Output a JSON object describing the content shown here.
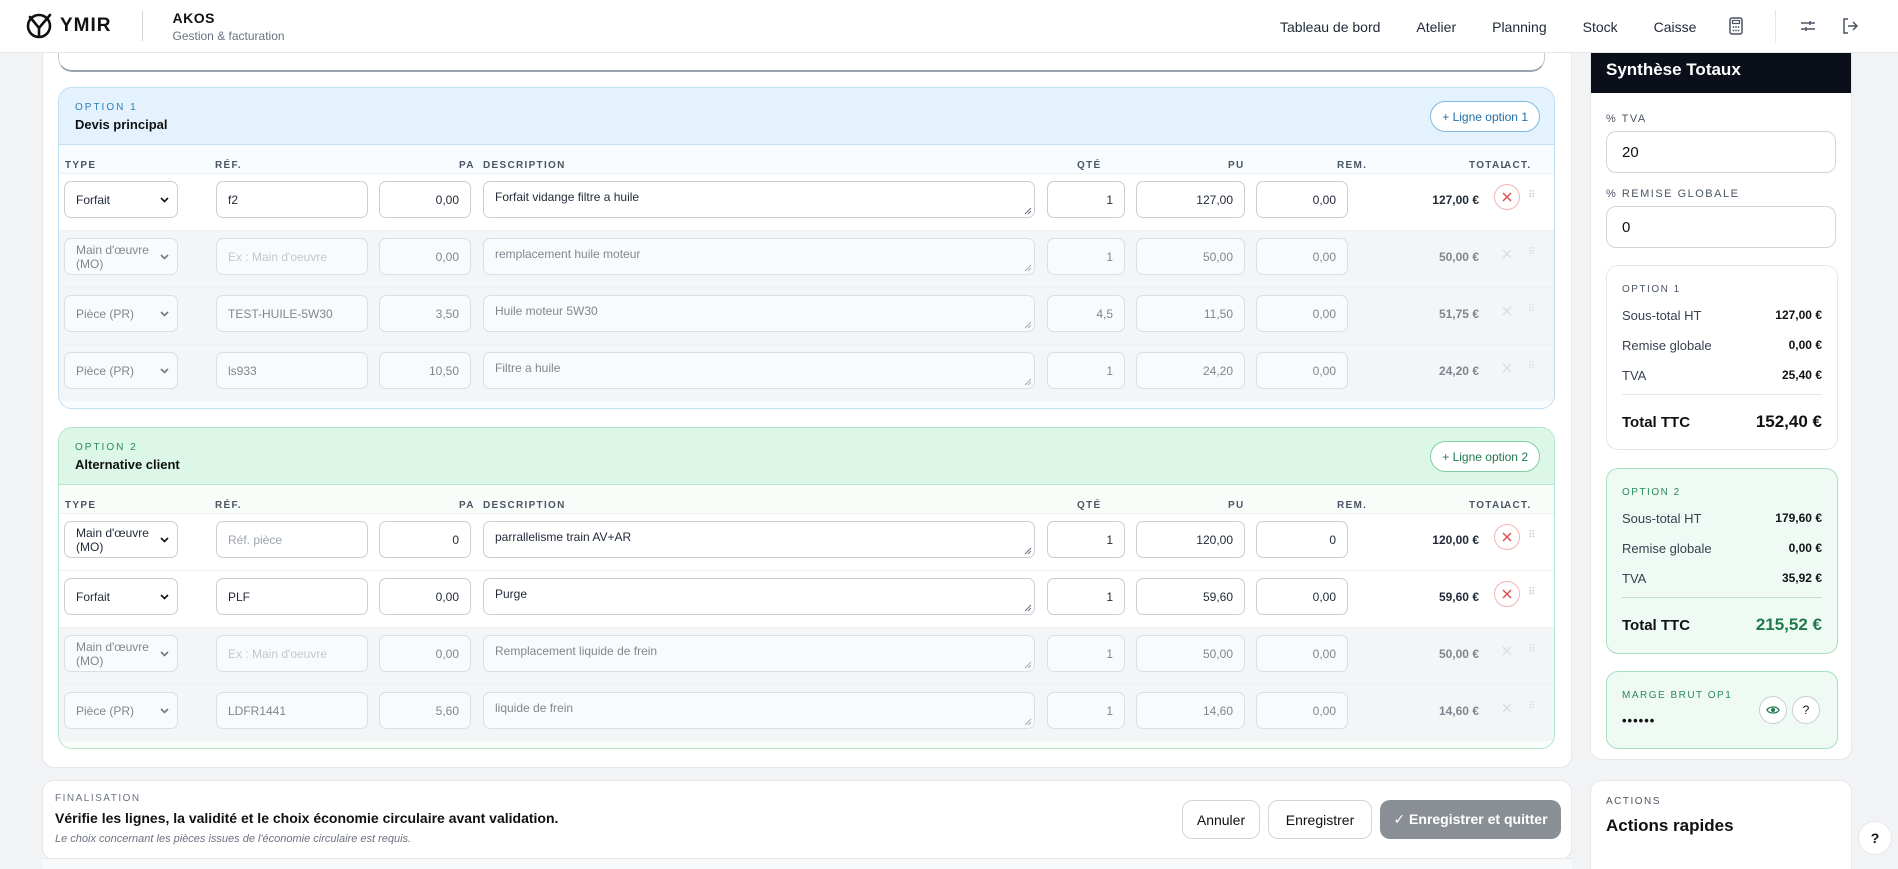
{
  "app": {
    "logo_text": "YMIR",
    "brand_title": "AKOS",
    "brand_subtitle": "Gestion & facturation"
  },
  "nav": {
    "items": [
      "Tableau de bord",
      "Atelier",
      "Planning",
      "Stock",
      "Caisse"
    ],
    "icons": [
      "calculator-icon",
      "sliders-icon",
      "logout-icon"
    ]
  },
  "columns": {
    "type": "TYPE",
    "ref": "RÉF.",
    "pa": "PA",
    "desc": "DESCRIPTION",
    "qty": "QTÉ",
    "pu": "PU",
    "rem": "REM.",
    "total": "TOTAL",
    "act": "ACT."
  },
  "option1": {
    "kicker": "OPTION 1",
    "name": "Devis principal",
    "add_label": "+ Ligne option 1",
    "rows": [
      {
        "type": "Forfait",
        "ref": "f2",
        "ref_placeholder": false,
        "pa": "0,00",
        "desc": "Forfait vidange filtre a huile",
        "qty": "1",
        "pu": "127,00",
        "rem": "0,00",
        "total": "127,00 €",
        "ghost": false
      },
      {
        "type": "Main d'œuvre (MO)",
        "ref": "Ex : Main d'oeuvre",
        "ref_placeholder": true,
        "pa": "0,00",
        "desc": "remplacement huile moteur",
        "qty": "1",
        "pu": "50,00",
        "rem": "0,00",
        "total": "50,00 €",
        "ghost": true
      },
      {
        "type": "Pièce (PR)",
        "ref": "TEST-HUILE-5W30",
        "ref_placeholder": false,
        "pa": "3,50",
        "desc": "Huile moteur 5W30",
        "qty": "4,5",
        "pu": "11,50",
        "rem": "0,00",
        "total": "51,75 €",
        "ghost": true
      },
      {
        "type": "Pièce (PR)",
        "ref": "ls933",
        "ref_placeholder": false,
        "pa": "10,50",
        "desc": "Filtre a huile",
        "qty": "1",
        "pu": "24,20",
        "rem": "0,00",
        "total": "24,20 €",
        "ghost": true
      }
    ]
  },
  "option2": {
    "kicker": "OPTION 2",
    "name": "Alternative client",
    "add_label": "+ Ligne option 2",
    "rows": [
      {
        "type": "Main d'œuvre (MO)",
        "ref": "Réf. pièce",
        "ref_placeholder": true,
        "pa": "0",
        "desc": "parrallelisme train AV+AR",
        "qty": "1",
        "pu": "120,00",
        "rem": "0",
        "total": "120,00 €",
        "ghost": false
      },
      {
        "type": "Forfait",
        "ref": "PLF",
        "ref_placeholder": false,
        "pa": "0,00",
        "desc": "Purge",
        "qty": "1",
        "pu": "59,60",
        "rem": "0,00",
        "total": "59,60 €",
        "ghost": false
      },
      {
        "type": "Main d'œuvre (MO)",
        "ref": "Ex : Main d'oeuvre",
        "ref_placeholder": true,
        "pa": "0,00",
        "desc": "Remplacement liquide de frein",
        "qty": "1",
        "pu": "50,00",
        "rem": "0,00",
        "total": "50,00 €",
        "ghost": true
      },
      {
        "type": "Pièce (PR)",
        "ref": "LDFR1441",
        "ref_placeholder": false,
        "pa": "5,60",
        "desc": "liquide de frein",
        "qty": "1",
        "pu": "14,60",
        "rem": "0,00",
        "total": "14,60 €",
        "ghost": true
      }
    ]
  },
  "finalisation": {
    "kicker": "FINALISATION",
    "title": "Vérifie les lignes, la validité et le choix économie circulaire avant validation.",
    "note": "Le choix concernant les pièces issues de l'économie circulaire est requis.",
    "cancel_label": "Annuler",
    "save_label": "Enregistrer",
    "save_quit_label": "✓ Enregistrer et quitter"
  },
  "summary": {
    "title": "Synthèse Totaux",
    "tva_label": "% TVA",
    "tva_value": "20",
    "remise_label": "% REMISE GLOBALE",
    "remise_value": "0",
    "option1": {
      "kicker": "OPTION 1",
      "subtotal_label": "Sous-total HT",
      "subtotal": "127,00 €",
      "remise_label": "Remise globale",
      "remise": "0,00 €",
      "tva_label": "TVA",
      "tva": "25,40 €",
      "total_label": "Total TTC",
      "total": "152,40 €"
    },
    "option2": {
      "kicker": "OPTION 2",
      "subtotal_label": "Sous-total HT",
      "subtotal": "179,60 €",
      "remise_label": "Remise globale",
      "remise": "0,00 €",
      "tva_label": "TVA",
      "tva": "35,92 €",
      "total_label": "Total TTC",
      "total": "215,52 €"
    },
    "marge_label": "MARGE BRUT OP1",
    "marge_value": "••••••",
    "help_label": "?"
  },
  "actions": {
    "kicker": "ACTIONS",
    "title": "Actions rapides"
  },
  "help_label": "?",
  "colors": {
    "option1_accent": "#e3f2fd",
    "option2_accent": "#dcf6e8",
    "dark_header": "#0a0f1a",
    "delete_red": "#e05050"
  }
}
